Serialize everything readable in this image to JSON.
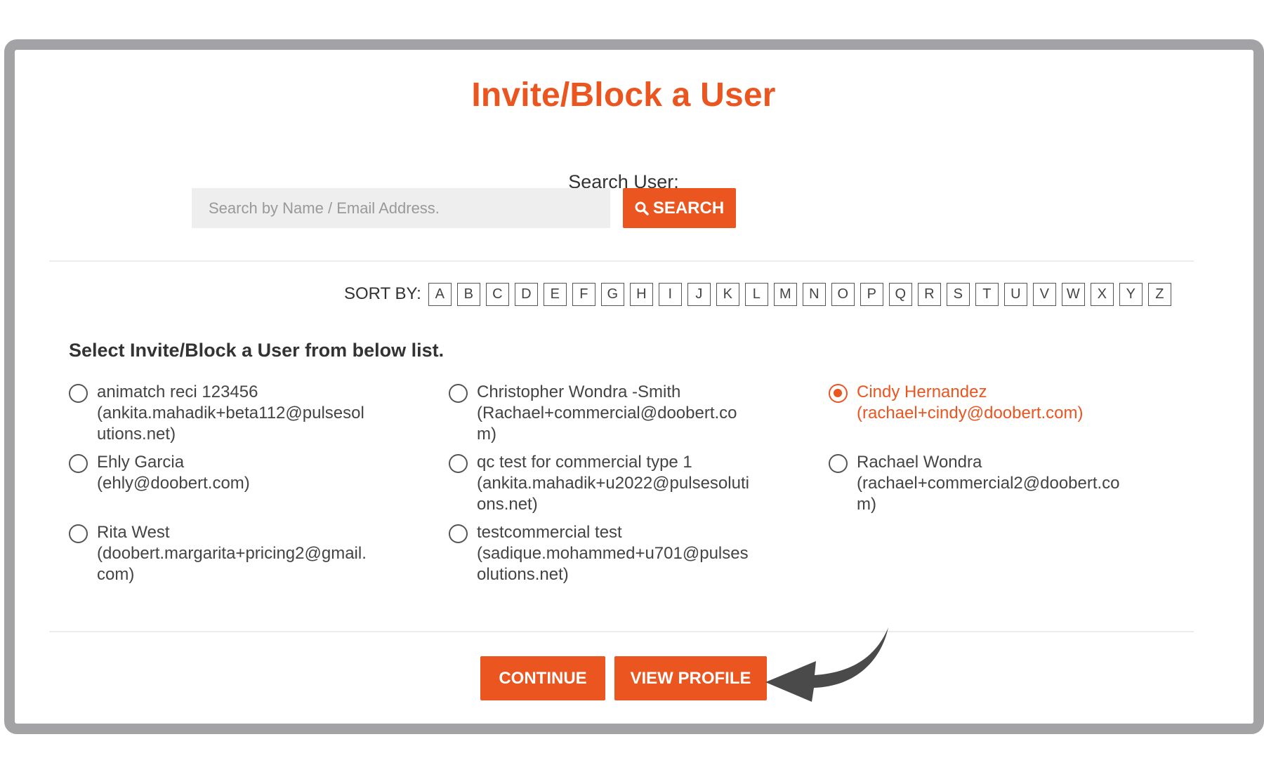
{
  "page": {
    "title": "Invite/Block a User"
  },
  "search": {
    "label": "Search User:",
    "placeholder": "Search by Name / Email Address.",
    "value": "",
    "button_label": "SEARCH",
    "button_icon": "search-icon"
  },
  "sort": {
    "label": "SORT BY:",
    "letters": [
      "A",
      "B",
      "C",
      "D",
      "E",
      "F",
      "G",
      "H",
      "I",
      "J",
      "K",
      "L",
      "M",
      "N",
      "O",
      "P",
      "Q",
      "R",
      "S",
      "T",
      "U",
      "V",
      "W",
      "X",
      "Y",
      "Z"
    ]
  },
  "list": {
    "instruction": "Select Invite/Block a User from below list.",
    "users": [
      {
        "name": "animatch reci 123456",
        "email": "(ankita.mahadik+beta112@pulsesolutions.net)",
        "selected": false
      },
      {
        "name": "Christopher Wondra -Smith",
        "email": "(Rachael+commercial@doobert.com)",
        "selected": false
      },
      {
        "name": "Cindy Hernandez",
        "email": "(rachael+cindy@doobert.com)",
        "selected": true
      },
      {
        "name": "Ehly Garcia",
        "email": "(ehly@doobert.com)",
        "selected": false
      },
      {
        "name": "qc test for commercial type 1",
        "email": "(ankita.mahadik+u2022@pulsesolutions.net)",
        "selected": false
      },
      {
        "name": "Rachael Wondra",
        "email": "(rachael+commercial2@doobert.com)",
        "selected": false
      },
      {
        "name": "Rita West",
        "email": "(doobert.margarita+pricing2@gmail.com)",
        "selected": false
      },
      {
        "name": "testcommercial test",
        "email": "(sadique.mohammed+u701@pulsesolutions.net)",
        "selected": false
      }
    ]
  },
  "actions": {
    "continue_label": "CONTINUE",
    "view_profile_label": "VIEW PROFILE"
  },
  "colors": {
    "accent": "#ea5520",
    "frame": "#a3a3a5",
    "input_bg": "#eeeeee"
  }
}
